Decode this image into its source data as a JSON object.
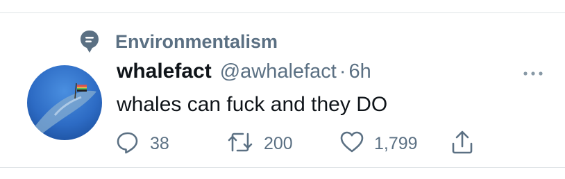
{
  "tweet": {
    "context_label": "Environmentalism",
    "context_icon": "topic-bubble-icon",
    "display_name": "whalefact",
    "handle": "@awhalefact",
    "separator": "·",
    "time": "6h",
    "text": "whales can fuck and they DO",
    "more_icon": "more-horizontal-icon",
    "actions": {
      "reply": {
        "icon": "reply-icon",
        "count": "38"
      },
      "retweet": {
        "icon": "retweet-icon",
        "count": "200"
      },
      "like": {
        "icon": "heart-icon",
        "count": "1,799"
      },
      "share": {
        "icon": "share-icon"
      }
    }
  },
  "colors": {
    "primary_text": "#0f1419",
    "secondary_text": "#5b7083",
    "divider": "#dfe3e6",
    "avatar_water": "#2d6bc4"
  }
}
